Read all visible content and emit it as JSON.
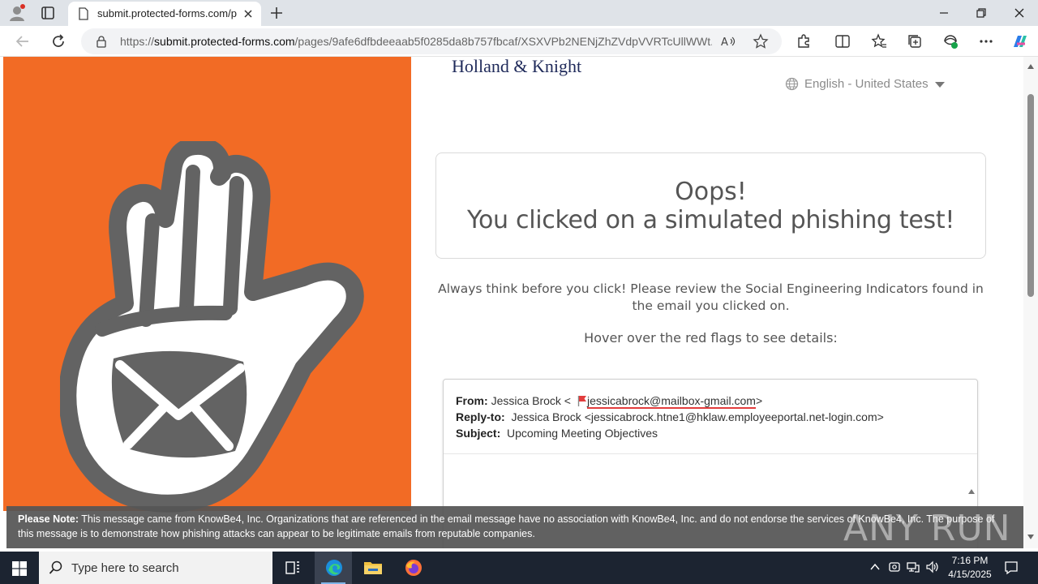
{
  "browser": {
    "tab_title": "submit.protected-forms.com/pa",
    "url_scheme": "https://",
    "url_host": "submit.protected-forms.com",
    "url_path": "/pages/9afe6dfbdeeaab5f0285da8b757fbcaf/XSXVPb2NENjZhZVdpVVRTcUllWWt..."
  },
  "page": {
    "logo": "Holland & Knight",
    "language": "English - United States",
    "headline": "Oops!",
    "subheadline": "You clicked on a simulated phishing test!",
    "instructions": "Always think before you click! Please review the Social Engineering Indicators found in the email you clicked on.",
    "hover_hint": "Hover over the red flags to see details:",
    "email": {
      "from_label": "From:",
      "from_name": "Jessica Brock <",
      "from_address": "jessicabrock@mailbox-gmail.com",
      "from_close": ">",
      "reply_label": "Reply-to:",
      "reply_value": "Jessica Brock <jessicabrock.htne1@hklaw.employeeportal.net-login.com>",
      "subject_label": "Subject:",
      "subject_value": "Upcoming Meeting Objectives"
    },
    "note_label": "Please Note:",
    "note_text": " This message came from KnowBe4, Inc. Organizations that are referenced in the email message have no association with KnowBe4, Inc. and do not endorse the services of KnowBe4, Inc. The purpose of this message is to demonstrate how phishing attacks can appear to be legitimate emails from reputable companies.",
    "watermark": "ANY RUN"
  },
  "taskbar": {
    "search_placeholder": "Type here to search",
    "time": "7:16 PM",
    "date": "4/15/2025"
  },
  "colors": {
    "brand_orange": "#f26b25",
    "hand_gray": "#636363",
    "flag_red": "#e23d3d",
    "logo_navy": "#1f2a5a"
  }
}
